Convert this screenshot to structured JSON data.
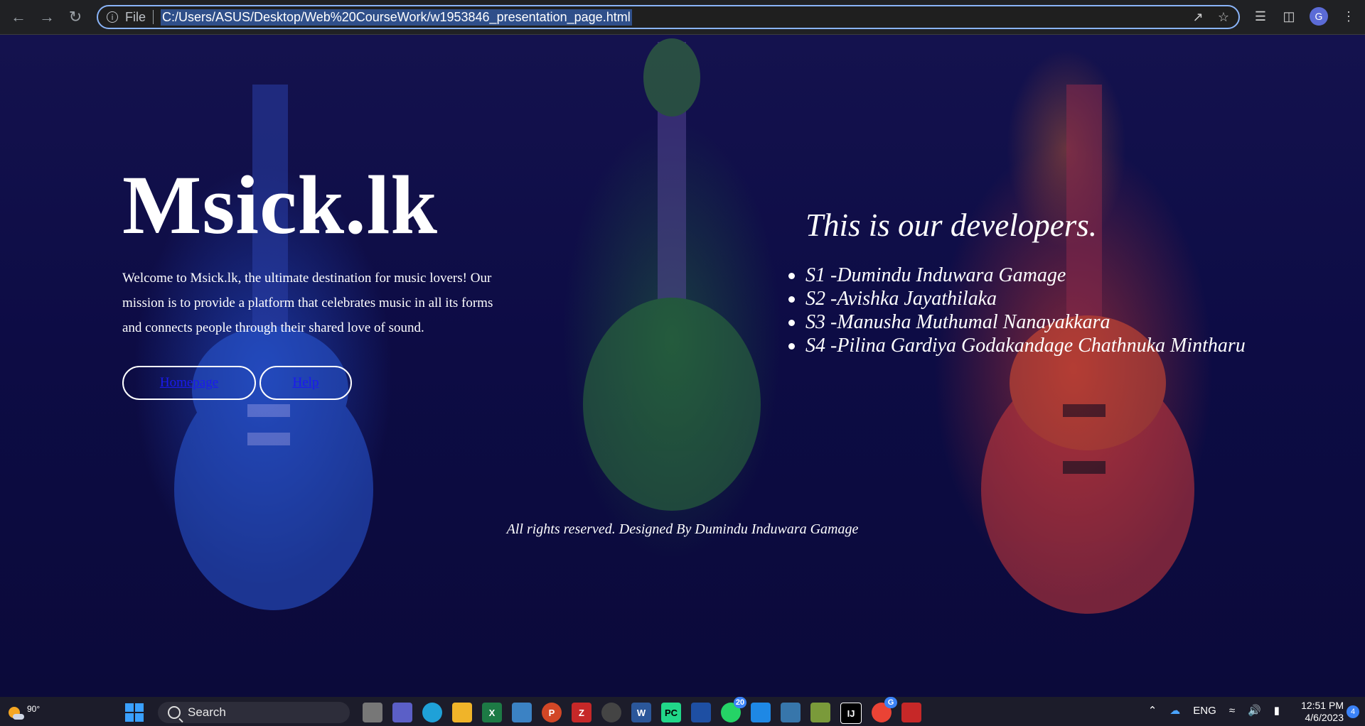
{
  "browser": {
    "file_label": "File",
    "url": "C:/Users/ASUS/Desktop/Web%20CourseWork/w1953846_presentation_page.html",
    "profile_initial": "G"
  },
  "page": {
    "site_title": "Msick.lk",
    "intro": "Welcome to Msick.lk, the ultimate destination for music lovers! Our mission is to provide a platform that celebrates music in all its forms and connects people through their shared love of sound.",
    "buttons": {
      "home": "Homepage",
      "help": "Help"
    },
    "developers_heading": "This is our developers.",
    "developers": [
      "S1 -Dumindu Induwara Gamage",
      "S2 -Avishka Jayathilaka",
      "S3 -Manusha Muthumal Nanayakkara",
      "S4 -Pilina Gardiya Godakandage Chathnuka Mintharu"
    ],
    "footer": "All rights reserved. Designed By Dumindu Induwara Gamage"
  },
  "taskbar": {
    "weather_temp": "90°",
    "search_label": "Search",
    "whatsapp_badge": "20",
    "chrome_badge": "G",
    "language": "ENG",
    "time": "12:51 PM",
    "date": "4/6/2023",
    "notification_count": "4"
  }
}
